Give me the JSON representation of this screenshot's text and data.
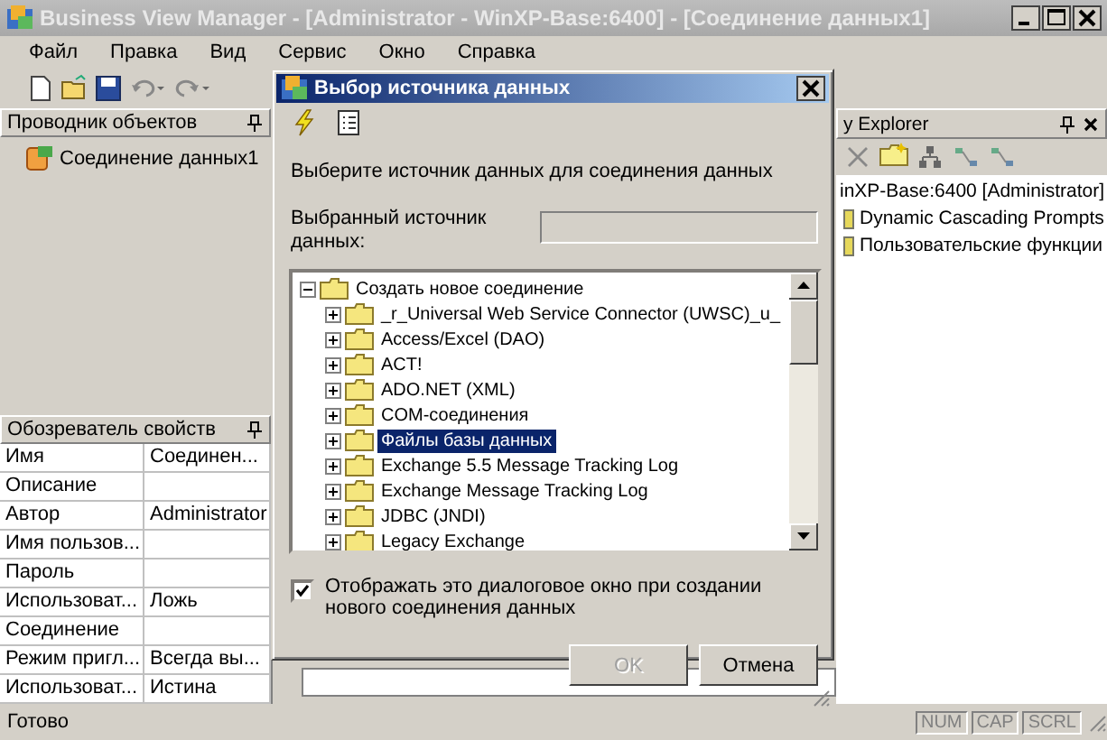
{
  "window": {
    "title": "Business View Manager - [Administrator - WinXP-Base:6400] - [Соединение данных1]"
  },
  "menu": [
    "Файл",
    "Правка",
    "Вид",
    "Сервис",
    "Окно",
    "Справка"
  ],
  "object_explorer": {
    "title": "Проводник объектов",
    "items": [
      {
        "label": "Соединение данных1"
      }
    ]
  },
  "properties": {
    "title": "Обозреватель свойств",
    "rows": [
      {
        "name": "Имя",
        "value": "Соединен..."
      },
      {
        "name": "Описание",
        "value": ""
      },
      {
        "name": "Автор",
        "value": "Administrator"
      },
      {
        "name": "Имя пользов...",
        "value": ""
      },
      {
        "name": "Пароль",
        "value": ""
      },
      {
        "name": "Использоват...",
        "value": "Ложь"
      },
      {
        "name": "Соединение",
        "value": ""
      },
      {
        "name": "Режим пригл...",
        "value": "Всегда вы..."
      },
      {
        "name": "Использоват...",
        "value": "Истина"
      }
    ]
  },
  "repository_explorer": {
    "title": "y Explorer",
    "items": [
      {
        "label": "inXP-Base:6400 [Administrator]",
        "children": [
          {
            "label": "Dynamic Cascading Prompts"
          },
          {
            "label": "Пользовательские функции"
          }
        ]
      }
    ]
  },
  "status_bar": {
    "text": "Готово",
    "indicators": [
      "NUM",
      "CAP",
      "SCRL"
    ]
  },
  "dialog": {
    "title": "Выбор источника данных",
    "instruction": "Выберите источник данных для соединения данных",
    "selected_source": {
      "label": "Выбранный источник данных:",
      "disabled": true
    },
    "sources": [
      {
        "label": "Создать новое соединение",
        "expanded": true,
        "children": [
          {
            "label": "_r_Universal Web Service Connector (UWSC)_u_",
            "expanded": false,
            "selected": false
          },
          {
            "label": "Access/Excel (DAO)",
            "expanded": false,
            "selected": false
          },
          {
            "label": "ACT!",
            "expanded": false,
            "selected": false
          },
          {
            "label": "ADO.NET (XML)",
            "expanded": false,
            "selected": false
          },
          {
            "label": "COM-соединения",
            "expanded": false,
            "selected": false
          },
          {
            "label": "Файлы базы данных",
            "expanded": false,
            "selected": true
          },
          {
            "label": "Exchange 5.5 Message Tracking Log",
            "expanded": false,
            "selected": false
          },
          {
            "label": "Exchange Message Tracking Log",
            "expanded": false,
            "selected": false
          },
          {
            "label": "JDBC (JNDI)",
            "expanded": false,
            "selected": false
          },
          {
            "label": "Legacy Exchange",
            "expanded": false,
            "selected": false
          }
        ]
      }
    ],
    "show_on_new": {
      "label": "Отображать это диалоговое окно при создании нового соединения данных",
      "checked": true
    },
    "buttons": [
      {
        "label": "OK",
        "disabled": true
      },
      {
        "label": "Отмена",
        "disabled": false
      }
    ]
  }
}
